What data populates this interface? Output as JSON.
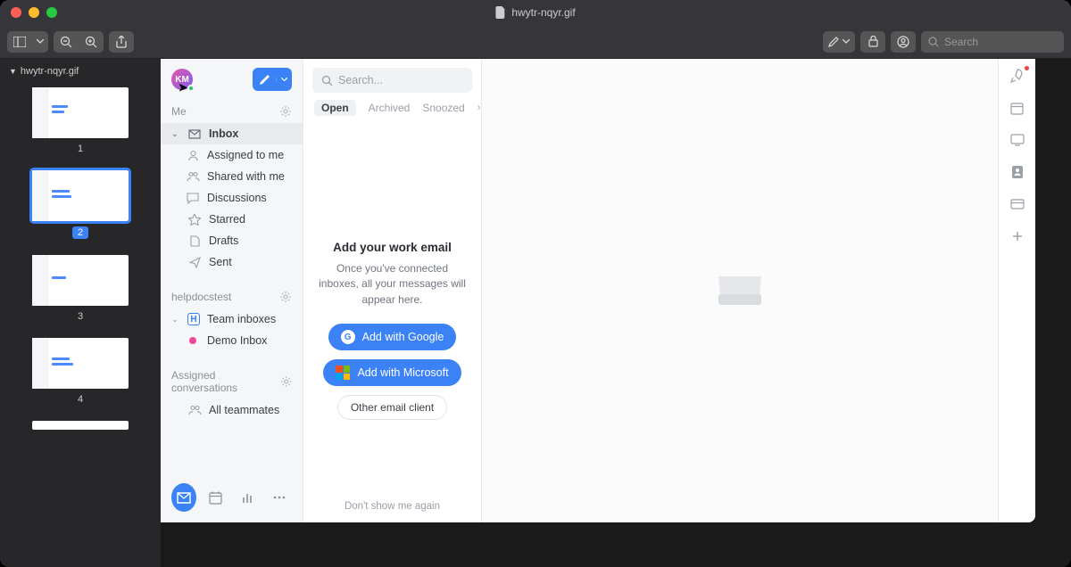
{
  "window": {
    "title": "hwytr-nqyr.gif",
    "search_placeholder": "Search"
  },
  "thumbs": {
    "filename": "hwytr-nqyr.gif",
    "items": [
      {
        "label": "1",
        "selected": false
      },
      {
        "label": "2",
        "selected": true
      },
      {
        "label": "3",
        "selected": false
      },
      {
        "label": "4",
        "selected": false
      }
    ]
  },
  "app": {
    "avatar_initials": "KM",
    "sections": {
      "me": {
        "label": "Me"
      },
      "team": {
        "label": "helpdocstest"
      },
      "assigned": {
        "label": "Assigned conversations"
      }
    },
    "nav": {
      "inbox": "Inbox",
      "assigned_to_me": "Assigned to me",
      "shared_with_me": "Shared with me",
      "discussions": "Discussions",
      "starred": "Starred",
      "drafts": "Drafts",
      "sent": "Sent",
      "team_inboxes": "Team inboxes",
      "demo_inbox": "Demo Inbox",
      "all_teammates": "All teammates"
    },
    "search_placeholder": "Search...",
    "tabs": {
      "open": "Open",
      "archived": "Archived",
      "snoozed": "Snoozed"
    },
    "empty": {
      "title": "Add your work email",
      "subtitle": "Once you've connected inboxes, all your messages will appear here.",
      "google": "Add with Google",
      "microsoft": "Add with Microsoft",
      "other": "Other email client",
      "dont_show": "Don't show me again"
    }
  }
}
